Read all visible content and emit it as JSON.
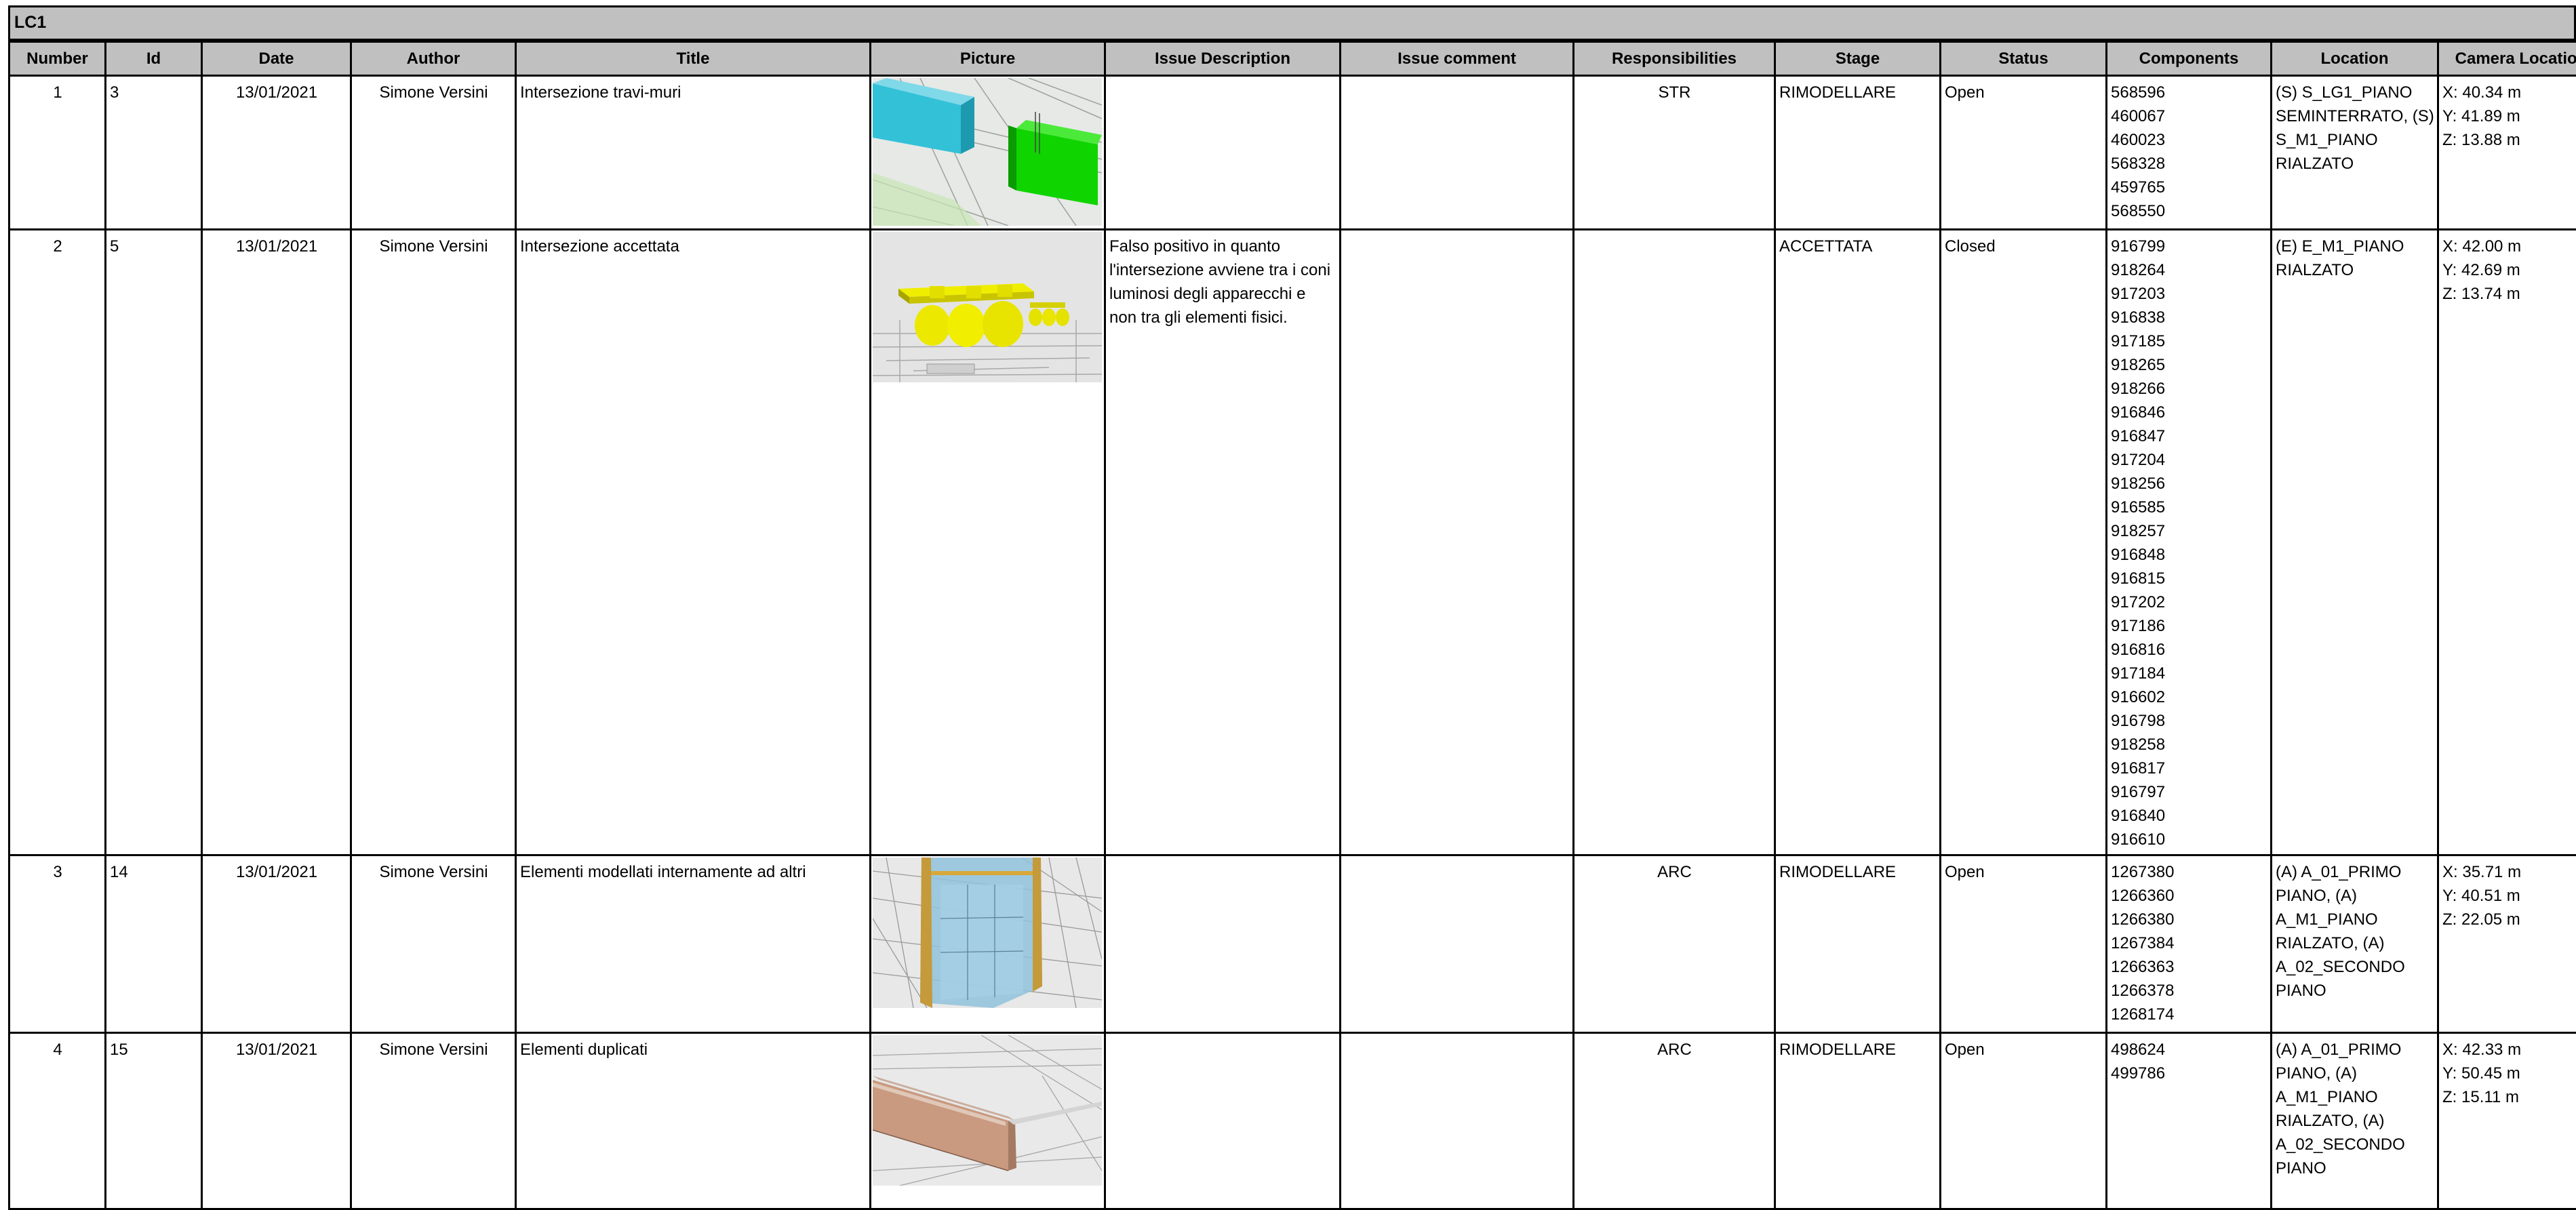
{
  "sheet_title": "LC1",
  "columns": [
    "Number",
    "Id",
    "Date",
    "Author",
    "Title",
    "Picture",
    "Issue Description",
    "Issue comment",
    "Responsibilities",
    "Stage",
    "Status",
    "Components",
    "Location",
    "Camera Location"
  ],
  "rows": [
    {
      "number": "1",
      "id": "3",
      "date": "13/01/2021",
      "author": "Simone Versini",
      "title": "Intersezione travi-muri",
      "picture": "clash-beams-walls-image",
      "issue_description": "",
      "issue_comment": "",
      "responsibilities": "STR",
      "stage": "RIMODELLARE",
      "status": "Open",
      "components": [
        "568596",
        "460067",
        "460023",
        "568328",
        "459765",
        "568550"
      ],
      "location": "(S) S_LG1_PIANO SEMINTERRATO, (S) S_M1_PIANO RIALZATO",
      "camera": [
        "X: 40.34 m",
        "Y: 41.89 m",
        "Z: 13.88 m"
      ]
    },
    {
      "number": "2",
      "id": "5",
      "date": "13/01/2021",
      "author": "Simone Versini",
      "title": "Intersezione accettata",
      "picture": "light-fixtures-image",
      "issue_description": "Falso positivo in quanto l'intersezione avviene tra i coni luminosi degli apparecchi e non tra gli elementi fisici.",
      "issue_comment": "",
      "responsibilities": "",
      "stage": "ACCETTATA",
      "status": "Closed",
      "components": [
        "916799",
        "918264",
        "917203",
        "916838",
        "917185",
        "918265",
        "918266",
        "916846",
        "916847",
        "917204",
        "918256",
        "916585",
        "918257",
        "916848",
        "916815",
        "917202",
        "917186",
        "916816",
        "917184",
        "916602",
        "916798",
        "918258",
        "916817",
        "916797",
        "916840",
        "916610"
      ],
      "location": "(E) E_M1_PIANO RIALZATO",
      "camera": [
        "X: 42.00 m",
        "Y: 42.69 m",
        "Z: 13.74 m"
      ]
    },
    {
      "number": "3",
      "id": "14",
      "date": "13/01/2021",
      "author": "Simone Versini",
      "title": "Elementi modellati internamente ad altri",
      "picture": "nested-elements-image",
      "issue_description": "",
      "issue_comment": "",
      "responsibilities": "ARC",
      "stage": "RIMODELLARE",
      "status": "Open",
      "components": [
        "1267380",
        "1266360",
        "1266380",
        "1267384",
        "1266363",
        "1266378",
        "1268174"
      ],
      "location": "(A) A_01_PRIMO PIANO, (A) A_M1_PIANO RIALZATO, (A) A_02_SECONDO PIANO",
      "camera": [
        "X: 35.71 m",
        "Y: 40.51 m",
        "Z: 22.05 m"
      ]
    },
    {
      "number": "4",
      "id": "15",
      "date": "13/01/2021",
      "author": "Simone Versini",
      "title": "Elementi duplicati",
      "picture": "duplicate-elements-image",
      "issue_description": "",
      "issue_comment": "",
      "responsibilities": "ARC",
      "stage": "RIMODELLARE",
      "status": "Open",
      "components": [
        "498624",
        "499786"
      ],
      "location": "(A) A_01_PRIMO PIANO, (A) A_M1_PIANO RIALZATO, (A) A_02_SECONDO PIANO",
      "camera": [
        "X: 42.33 m",
        "Y: 50.45 m",
        "Z: 15.11 m"
      ]
    }
  ]
}
